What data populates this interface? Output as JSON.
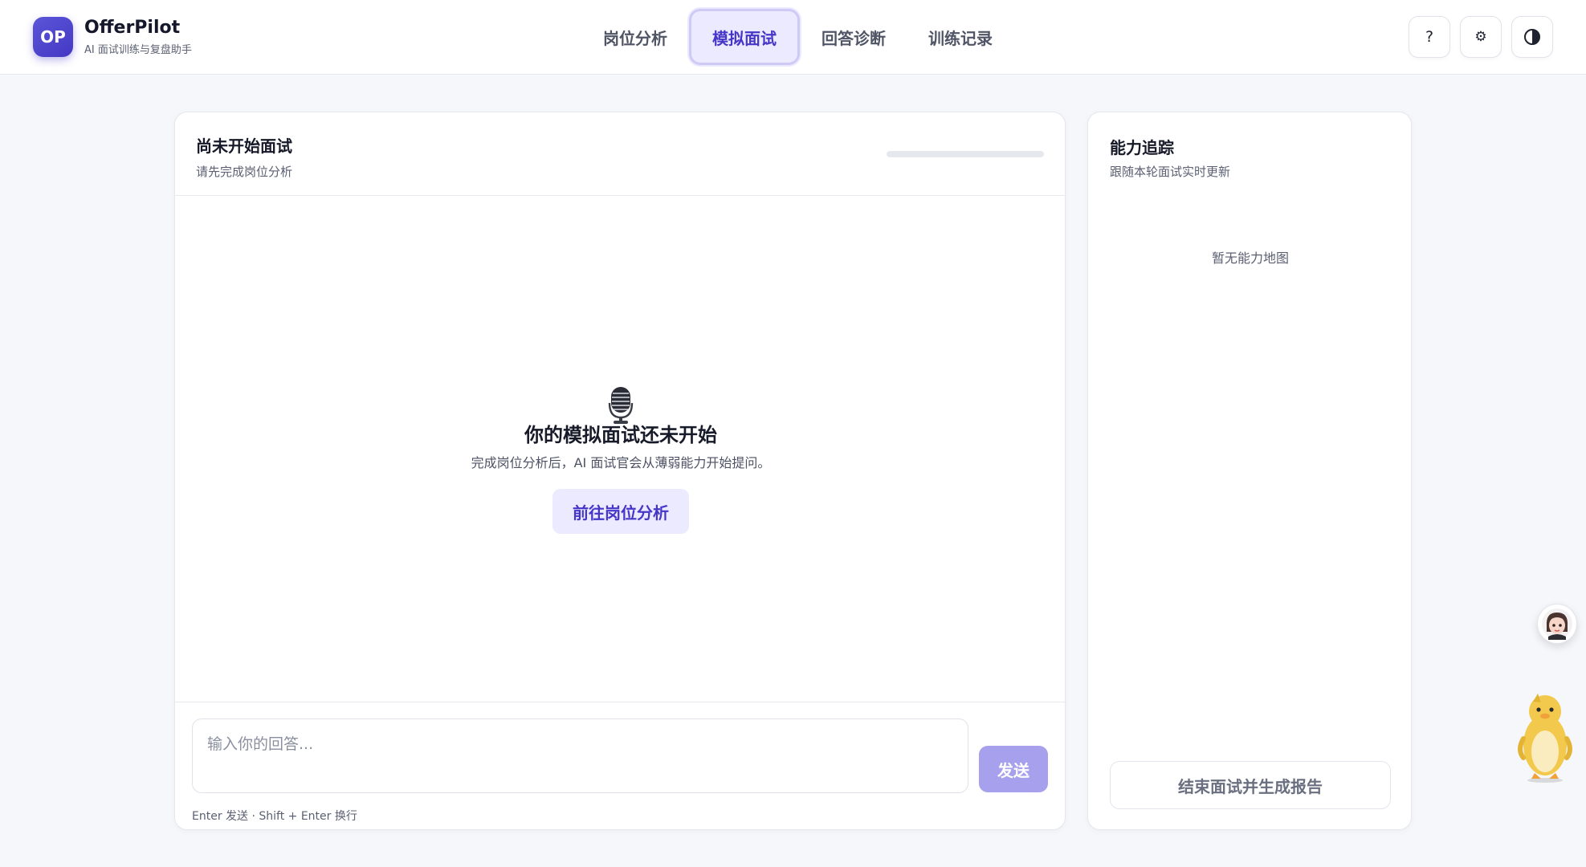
{
  "app": {
    "logo_text": "OP",
    "name": "OfferPilot",
    "subtitle": "AI 面试训练与复盘助手"
  },
  "nav": {
    "tabs": [
      {
        "label": "岗位分析",
        "active": false
      },
      {
        "label": "模拟面试",
        "active": true
      },
      {
        "label": "回答诊断",
        "active": false
      },
      {
        "label": "训练记录",
        "active": false
      }
    ]
  },
  "toolbar": {
    "help_label": "?",
    "settings_label": "⚙",
    "theme_label": "◐"
  },
  "interview": {
    "status_title": "尚未开始面试",
    "status_subtitle": "请先完成岗位分析",
    "progress": 0,
    "empty_icon": "microphone-icon",
    "empty_title": "你的模拟面试还未开始",
    "empty_desc": "完成岗位分析后，AI 面试官会从薄弱能力开始提问。",
    "go_button": "前往岗位分析",
    "answer_placeholder": "输入你的回答...",
    "send_button": "发送",
    "hint": "Enter 发送 · Shift + Enter 换行"
  },
  "ability": {
    "title": "能力追踪",
    "subtitle": "跟随本轮面试实时更新",
    "empty": "暂无能力地图",
    "end_button": "结束面试并生成报告"
  },
  "floating": {
    "assistant_icon": "assistant-avatar-icon",
    "mascot_icon": "duck-mascot-icon"
  },
  "colors": {
    "accent": "#4536c7",
    "accent_soft": "#eceaff",
    "send_disabled": "#a7a0ec",
    "background": "#f6f7fb"
  }
}
